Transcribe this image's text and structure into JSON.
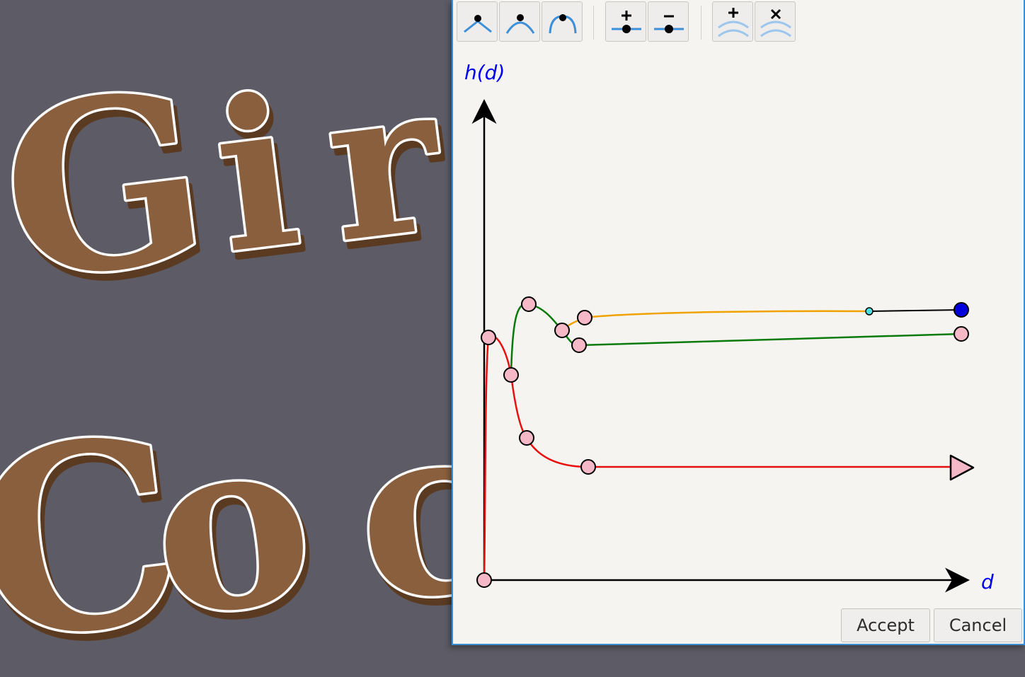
{
  "viewport": {
    "letters_top": [
      "G",
      "i",
      "r"
    ],
    "letters_bottom": [
      "C",
      "o",
      "c"
    ],
    "background_color": "#5d5c66",
    "letter_fill": "#8a5e3c",
    "letter_outline": "#ffffff"
  },
  "toolbar": {
    "buttons": [
      {
        "name": "corner-point-icon",
        "tooltip": "Corner point"
      },
      {
        "name": "smooth-point-icon",
        "tooltip": "Smooth point"
      },
      {
        "name": "symmetric-point-icon",
        "tooltip": "Symmetric point"
      },
      {
        "name": "add-point-icon",
        "tooltip": "Add point"
      },
      {
        "name": "remove-point-icon",
        "tooltip": "Remove point"
      },
      {
        "name": "add-curve-icon",
        "tooltip": "Add curve"
      },
      {
        "name": "remove-curve-icon",
        "tooltip": "Remove curve"
      }
    ]
  },
  "graph": {
    "y_label": "h(d)",
    "x_label": "d",
    "label_color": "#0000ee",
    "curves": [
      {
        "name": "red",
        "color": "#e8100f"
      },
      {
        "name": "green",
        "color": "#0a7a0a"
      },
      {
        "name": "orange",
        "color": "#f0a200"
      },
      {
        "name": "black",
        "color": "#000000"
      }
    ],
    "control_point_color": "#f4b8c6",
    "selected_point_color": "#0000dd",
    "handle_point_color": "#4ee0e0"
  },
  "buttons": {
    "accept": "Accept",
    "cancel": "Cancel"
  }
}
